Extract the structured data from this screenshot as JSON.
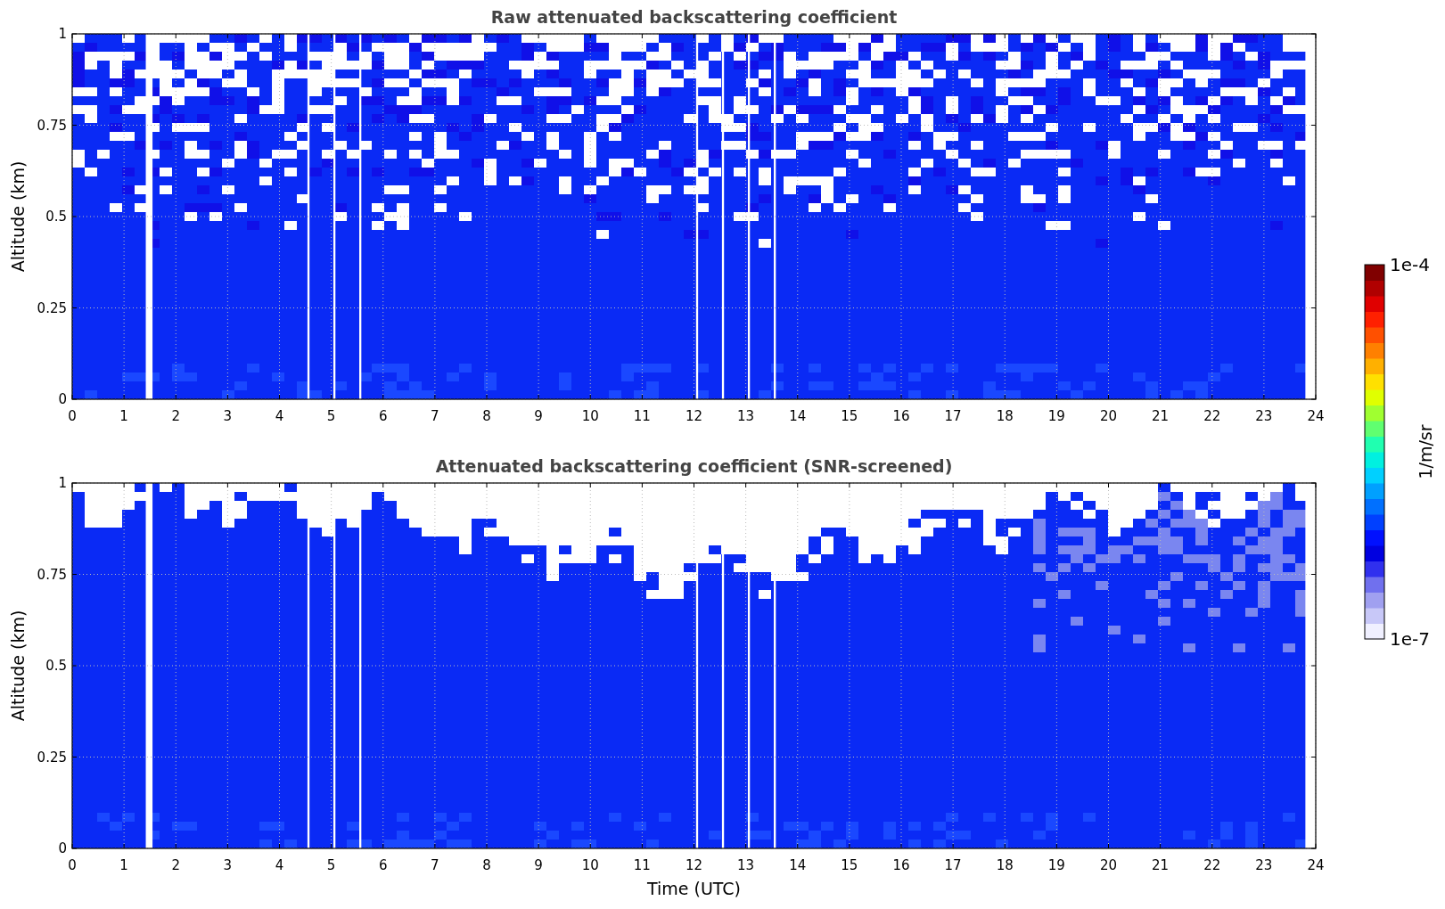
{
  "figure": {
    "panels": [
      {
        "kind": "raw",
        "title": "Raw attenuated backscattering coefficient",
        "ylabel": "Altitude (km)",
        "yticks": [
          "1",
          "0.75",
          "0.5",
          "0.25",
          "0"
        ],
        "xticks": [
          "0",
          "1",
          "2",
          "3",
          "4",
          "5",
          "6",
          "7",
          "8",
          "9",
          "10",
          "11",
          "12",
          "13",
          "14",
          "15",
          "16",
          "17",
          "18",
          "19",
          "20",
          "21",
          "22",
          "23",
          "24"
        ]
      },
      {
        "kind": "screened",
        "title": "Attenuated backscattering coefficient (SNR-screened)",
        "ylabel": "Altitude (km)",
        "yticks": [
          "1",
          "0.75",
          "0.5",
          "0.25",
          "0"
        ],
        "xticks": [
          "0",
          "1",
          "2",
          "3",
          "4",
          "5",
          "6",
          "7",
          "8",
          "9",
          "10",
          "11",
          "12",
          "13",
          "14",
          "15",
          "16",
          "17",
          "18",
          "19",
          "20",
          "21",
          "22",
          "23",
          "24"
        ]
      }
    ],
    "xlabel": "Time (UTC)",
    "colorbar": {
      "label": "1/m/sr",
      "max_label": "1e-4",
      "min_label": "1e-7"
    }
  }
}
